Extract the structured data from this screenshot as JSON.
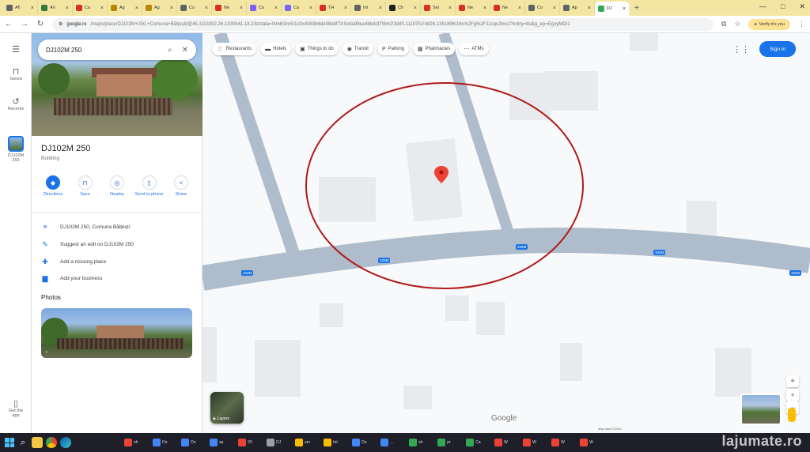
{
  "browser": {
    "tabs": [
      {
        "label": "Af\\",
        "color": "#5f6368"
      },
      {
        "label": "Ar\\",
        "color": "#2e7d32"
      },
      {
        "label": "Ca",
        "color": "#d93025"
      },
      {
        "label": "Ag",
        "color": "#b8860b"
      },
      {
        "label": "Ag",
        "color": "#b8860b"
      },
      {
        "label": "Co",
        "color": "#5f6368"
      },
      {
        "label": "Ne",
        "color": "#d93025"
      },
      {
        "label": "Co",
        "color": "#7b61ff"
      },
      {
        "label": "Ca",
        "color": "#7b61ff"
      },
      {
        "label": "TH",
        "color": "#d93025"
      },
      {
        "label": "Int",
        "color": "#5f6368"
      },
      {
        "label": "Ch",
        "color": "#202124"
      },
      {
        "label": "Sei",
        "color": "#d93025"
      },
      {
        "label": "Ne",
        "color": "#d93025"
      },
      {
        "label": "Ne",
        "color": "#d93025"
      },
      {
        "label": "Co",
        "color": "#5f6368"
      },
      {
        "label": "Ap",
        "color": "#5f6368"
      },
      {
        "label": "DJ",
        "color": "#34a853"
      }
    ],
    "active_tab_index": 17,
    "new_tab": "+",
    "window_controls": [
      "—",
      "□",
      "✕"
    ],
    "url_host": "google.ro",
    "url_rest": "/maps/place/DJ102M+250,+Comuna+Bălțești/@45.1113352,26.1330541,18.23z/data=!4m6!3m5!1s0x40b3b6de98e8f73:0x8a99ea4bbdcf7!8m2!3d45.1118751!4d26.1351896!16s%2Fg%2F11cqu3mx2?entry=ttu&g_ep=EgoyMDI1",
    "verify_label": "Verify it's you"
  },
  "rail": {
    "menu_icon": "☰",
    "saved": "Saved",
    "recents": "Recents",
    "place": "DJ102M 250",
    "get_app": "Get the app"
  },
  "panel": {
    "search_value": "DJ102M 250",
    "title": "DJ102M 250",
    "category": "Building",
    "actions": [
      {
        "label": "Directions",
        "icon": "◆"
      },
      {
        "label": "Save",
        "icon": "⊓"
      },
      {
        "label": "Nearby",
        "icon": "◎"
      },
      {
        "label": "Send to phone",
        "icon": "▯"
      },
      {
        "label": "Share",
        "icon": "<"
      }
    ],
    "address": "DJ102M 250, Comuna Bălțești",
    "suggest_edit": "Suggest an edit on DJ102M 250",
    "add_place": "Add a missing place",
    "add_business": "Add your business",
    "photos_heading": "Photos"
  },
  "map": {
    "chips": [
      {
        "label": "Restaurants",
        "icon": "🍴"
      },
      {
        "label": "Hotels",
        "icon": "▬"
      },
      {
        "label": "Things to do",
        "icon": "▣"
      },
      {
        "label": "Transit",
        "icon": "◉"
      },
      {
        "label": "Parking",
        "icon": "P"
      },
      {
        "label": "Pharmacies",
        "icon": "▦"
      },
      {
        "label": "ATMs",
        "icon": "⋯"
      }
    ],
    "signin_label": "Sign in",
    "road_badge": "102M",
    "layers_label": "Layers",
    "google_logo": "Google",
    "footer": "Map data ©2025",
    "colors": {
      "road": "#aebccb",
      "building": "#e8eaed",
      "highlight_ring": "#b11a1a",
      "pin": "#ea4335"
    }
  },
  "taskbar": {
    "watermark": "lajumate.ro",
    "apps": [
      {
        "label": "sh",
        "color": "#ea4335"
      },
      {
        "label": "Do",
        "color": "#4285f4"
      },
      {
        "label": "Do",
        "color": "#4285f4"
      },
      {
        "label": "sp",
        "color": "#4285f4"
      },
      {
        "label": "20",
        "color": "#ea4335"
      },
      {
        "label": "DJ",
        "color": "#9aa0a6"
      },
      {
        "label": "sm",
        "color": "#fbbc04"
      },
      {
        "label": "Int",
        "color": "#fbbc04"
      },
      {
        "label": "Do",
        "color": "#4285f4"
      },
      {
        "label": "...",
        "color": "#4285f4"
      },
      {
        "label": "sh",
        "color": "#34a853"
      },
      {
        "label": "pr",
        "color": "#34a853"
      },
      {
        "label": "Ca",
        "color": "#34a853"
      },
      {
        "label": "W",
        "color": "#ea4335"
      },
      {
        "label": "W",
        "color": "#ea4335"
      },
      {
        "label": "W",
        "color": "#ea4335"
      },
      {
        "label": "W",
        "color": "#ea4335"
      }
    ]
  }
}
